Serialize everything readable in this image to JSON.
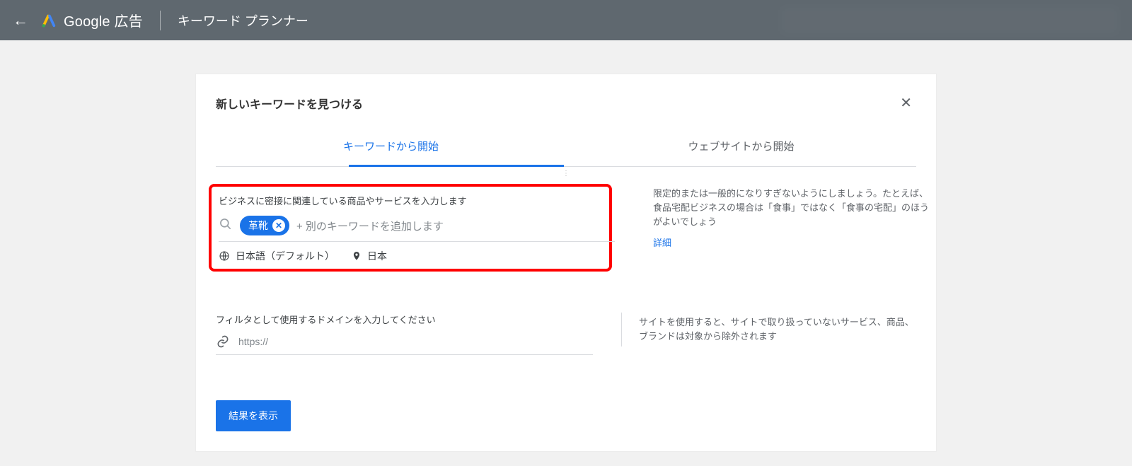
{
  "header": {
    "product": "Google 広告",
    "tool": "キーワード プランナー"
  },
  "card": {
    "title": "新しいキーワードを見つける"
  },
  "tabs": {
    "keyword": "キーワードから開始",
    "website": "ウェブサイトから開始",
    "active": "keyword"
  },
  "keyword_section": {
    "label": "ビジネスに密接に関連している商品やサービスを入力します",
    "chip": "革靴",
    "placeholder": "+ 別のキーワードを追加します",
    "language": "日本語（デフォルト）",
    "location": "日本"
  },
  "hint1": {
    "text": "限定的または一般的になりすぎないようにしましょう。たとえば、食品宅配ビジネスの場合は「食事」ではなく「食事の宅配」のほうがよいでしょう",
    "link": "詳細"
  },
  "domain_section": {
    "label": "フィルタとして使用するドメインを入力してください",
    "placeholder": "https://"
  },
  "hint2": {
    "text": "サイトを使用すると、サイトで取り扱っていないサービス、商品、ブランドは対象から除外されます"
  },
  "submit": {
    "label": "結果を表示"
  }
}
